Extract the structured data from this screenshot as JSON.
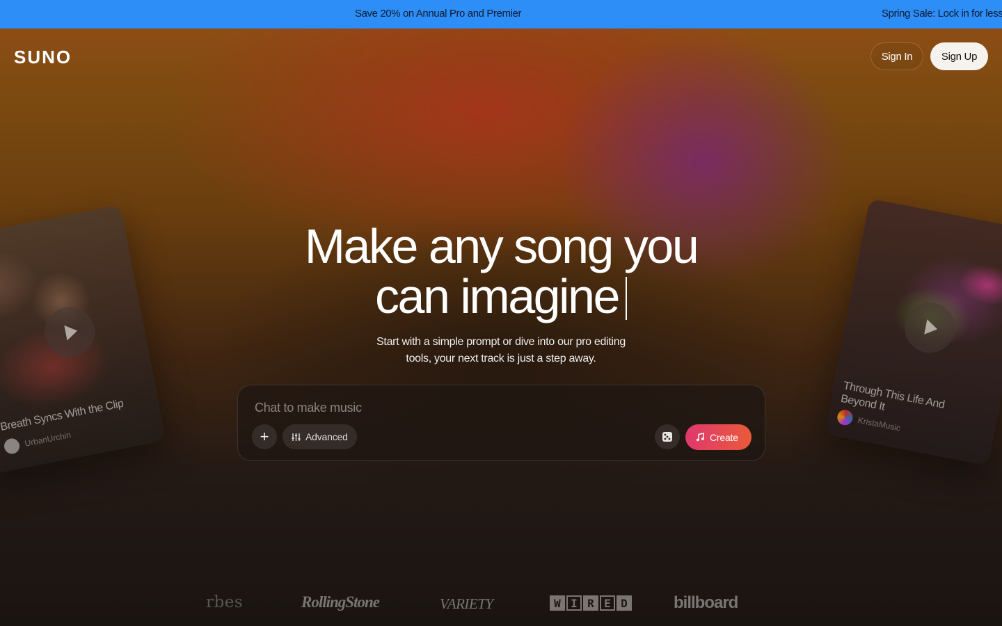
{
  "promo": {
    "messages": [
      "Save 20% on Annual Pro and Premier",
      "Spring Sale: Lock in for less"
    ]
  },
  "header": {
    "logo": "SUNO",
    "sign_in": "Sign In",
    "sign_up": "Sign Up"
  },
  "hero": {
    "headline_line1": "Make any song you",
    "headline_line2": "can imagine",
    "subtitle_line1": "Start with a simple prompt or dive into our pro editing",
    "subtitle_line2": "tools, your next track is just a step away."
  },
  "prompt": {
    "placeholder": "Chat to make music",
    "add_label": "+",
    "advanced_label": "Advanced",
    "create_label": "Create"
  },
  "cards": [
    {
      "title": "Breath Syncs With the Clip",
      "artist": "UrbanUrchin"
    },
    {
      "title": "Through This Life And Beyond It",
      "artist": "KristaMusic"
    }
  ],
  "press": {
    "forbes": "rbes",
    "rolling_stone": "RollingStone",
    "variety": "VARIETY",
    "wired": [
      "W",
      "I",
      "R",
      "E",
      "D"
    ],
    "billboard": "billboard"
  },
  "colors": {
    "promo_bg": "#2e8ef8",
    "create_gradient_start": "#e0386e",
    "create_gradient_end": "#ea5a3a"
  },
  "icons": [
    "plus-icon",
    "sliders-icon",
    "dice-icon",
    "music-note-icon",
    "play-icon"
  ]
}
